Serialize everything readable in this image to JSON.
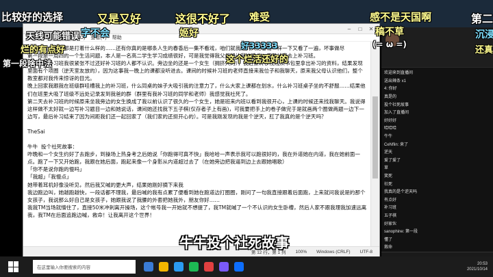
{
  "notepad": {
    "title": "",
    "menu": [
      "文件(F)",
      "编辑(E)",
      "格式(O)",
      "查看(V)",
      "帮助"
    ],
    "paragraphs": [
      "那时候我们的心都是打着什么样的……还有你真的是哪条人生的春香后一集不看戏，咱们就我这几天把春物一样一下又看了一遍，坏事做尽",
      "第一段是一周四的一个生活问题，本人是一名高二学生学习成绩很好，可是我觉得我父母想让我冲清北，于是让我去上补习班。",
      "第一天去补习班我很紧张不过还好补习班的人都不认识。旁边坐的还是一个女生（拥挤大的），我赶紧转移视线从书包里拿出补习的资料，结果发现里面有个项圈（逆天室友放的），因为这事我一晚上的课都没听进去。课间的时候补习班的老师直接来我位子和我聊天，原来我父母认识他们，整个教室都对我传来惊讶的目光。",
      "晚上回家我跟我在班级群哇槽我上的补习班，什么同桌的妹子大吸引我的注意力了，什么大家上课都在划水，什么补习班桌子坐的不舒服……结果他们在班里大吸了班级不远处记录发到我爸的群（群里有我补习班的同学和老师）我感觉我社死了。",
      "第二天去补习班的时候原来坐我旁边的女生换成了我以前认识了很久的一个女生，她是班来内班以看到我很开心，上课的时候还来找我聊天。我说得这样做不太好就一边写补习题目一边和她说话，课间她还找我下五子棋(仅存者子上有画)，可我要把手上的卷子做完于是就画两个圈做两题一边下一边写，最后补习结束了因为间距我们还一起回家了（我们家的还挺开心的）。可是我刚发现的我是个逆天，肛了我真的是个逆天吗？",
      "TheSai",
      "牛牛  投个社死故事：",
      "咋晚和一个女生约好了去跑步，到操场上热身考之后她说「你跑得可真不快」我哈哈一声表示我可以跑很好的，我在外道她在内道，我在她前面一点。跑了一下又开始跑，我跟在她后面，跑起来像一个身影从内道超过去了（在她旁边把我逼到边上去跟她唱歌）",
      "「你不是说你跑的慢吗」",
      "「我超」「我慢点」",
      "她带着耳机好像没听见，然后我又喊的更大声，结果她刚好摘下来我",
      "我边跑边叫，她越跑越快，一段话都不理我，最后喊的我有点累了便看到她在跑道边打圈圈，刚问了一句我直接跟着后面跑，上来就问我说是的那个女孩子，我说那么好自己是女孩子，她跟我说了我腰的外套把她我外，朋友你好……",
      "我我TM当场就懵住了，直接50米冲刺离开操场，这个帐号我一开始就不想提了，我TM就喊了一个不认识的女生卧槽，然后人家不跟我理我加速远离我，我TM在后面追跑边喊，救命！让我离开这个世界！"
    ],
    "status": [
      "第 12 行，第 1 列",
      "100%",
      "Windows (CRLF)",
      "UTF-8"
    ]
  },
  "subtitle": "牛牛投个社死故事",
  "danmaku": [
    {
      "text": "比较好的选择",
      "color": "#ffffff"
    },
    {
      "text": "天线可能错误",
      "color": "#ffffff"
    },
    {
      "text": "烂的有点好",
      "color": "#fffb8f"
    },
    {
      "text": "第一段啥中法",
      "color": "#ffffff"
    },
    {
      "text": "又是又好",
      "color": "#fffb8f"
    },
    {
      "text": "字不会",
      "color": "#7fe0ff"
    },
    {
      "text": "这很不好了",
      "color": "#fffb8f"
    },
    {
      "text": "姬好",
      "color": "#fffb8f"
    },
    {
      "text": "难受",
      "color": "#fffb8f"
    },
    {
      "text": "这个烂活还好的",
      "color": "#fffb8f"
    },
    {
      "text": "好33333",
      "color": "#7fe0ff"
    },
    {
      "text": "感不是天国啊",
      "color": "#fffb8f"
    },
    {
      "text": "稿不草",
      "color": "#fffb8f"
    },
    {
      "text": "(= ω =)",
      "color": "#ffffff"
    },
    {
      "text": "第二",
      "color": "#ffffff"
    },
    {
      "text": "沉浸",
      "color": "#7fe0ff"
    },
    {
      "text": "还真",
      "color": "#fffb8f"
    }
  ],
  "chat": {
    "header_name": "",
    "header_sub": "",
    "header_info": "",
    "messages": [
      {
        "badge": "",
        "name": "",
        "text": "欢迎来到直播间"
      },
      {
        "badge": "",
        "name": "",
        "text": "送出辣条 x1"
      },
      {
        "badge": "",
        "name": "",
        "text": "4: 你好"
      },
      {
        "badge": "",
        "name": "",
        "text": "真是的"
      },
      {
        "badge": "",
        "name": "",
        "text": "投个社死故事"
      },
      {
        "badge": "",
        "name": "",
        "text": "加入了直播间"
      },
      {
        "badge": "",
        "name": "",
        "text": "好好好"
      },
      {
        "badge": "",
        "name": "",
        "text": "哈哈哈"
      },
      {
        "badge": "",
        "name": "",
        "text": "牛牛"
      },
      {
        "badge": "",
        "name": "",
        "text": "CeNflin: 来了"
      },
      {
        "badge": "",
        "name": "",
        "text": "逆天"
      },
      {
        "badge": "",
        "name": "",
        "text": "爱了爱了"
      },
      {
        "badge": "",
        "name": "",
        "text": "草"
      },
      {
        "badge": "",
        "name": "",
        "text": "笑死"
      },
      {
        "badge": "",
        "name": "",
        "text": "社死"
      },
      {
        "badge": "",
        "name": "",
        "text": "我真的是个逆天吗"
      },
      {
        "badge": "",
        "name": "",
        "text": "有点好"
      },
      {
        "badge": "",
        "name": "",
        "text": "补习班"
      },
      {
        "badge": "",
        "name": "",
        "text": "五子棋"
      },
      {
        "badge": "",
        "name": "",
        "text": "好家伙"
      },
      {
        "badge": "",
        "name": "",
        "text": "sanophine: 第一段"
      },
      {
        "badge": "",
        "name": "",
        "text": "懂了"
      },
      {
        "badge": "",
        "name": "",
        "text": "救命"
      }
    ]
  },
  "taskbar": {
    "search_placeholder": "在这里输入你要搜索的内容",
    "time": "20:53",
    "date": "2021/10/14"
  }
}
